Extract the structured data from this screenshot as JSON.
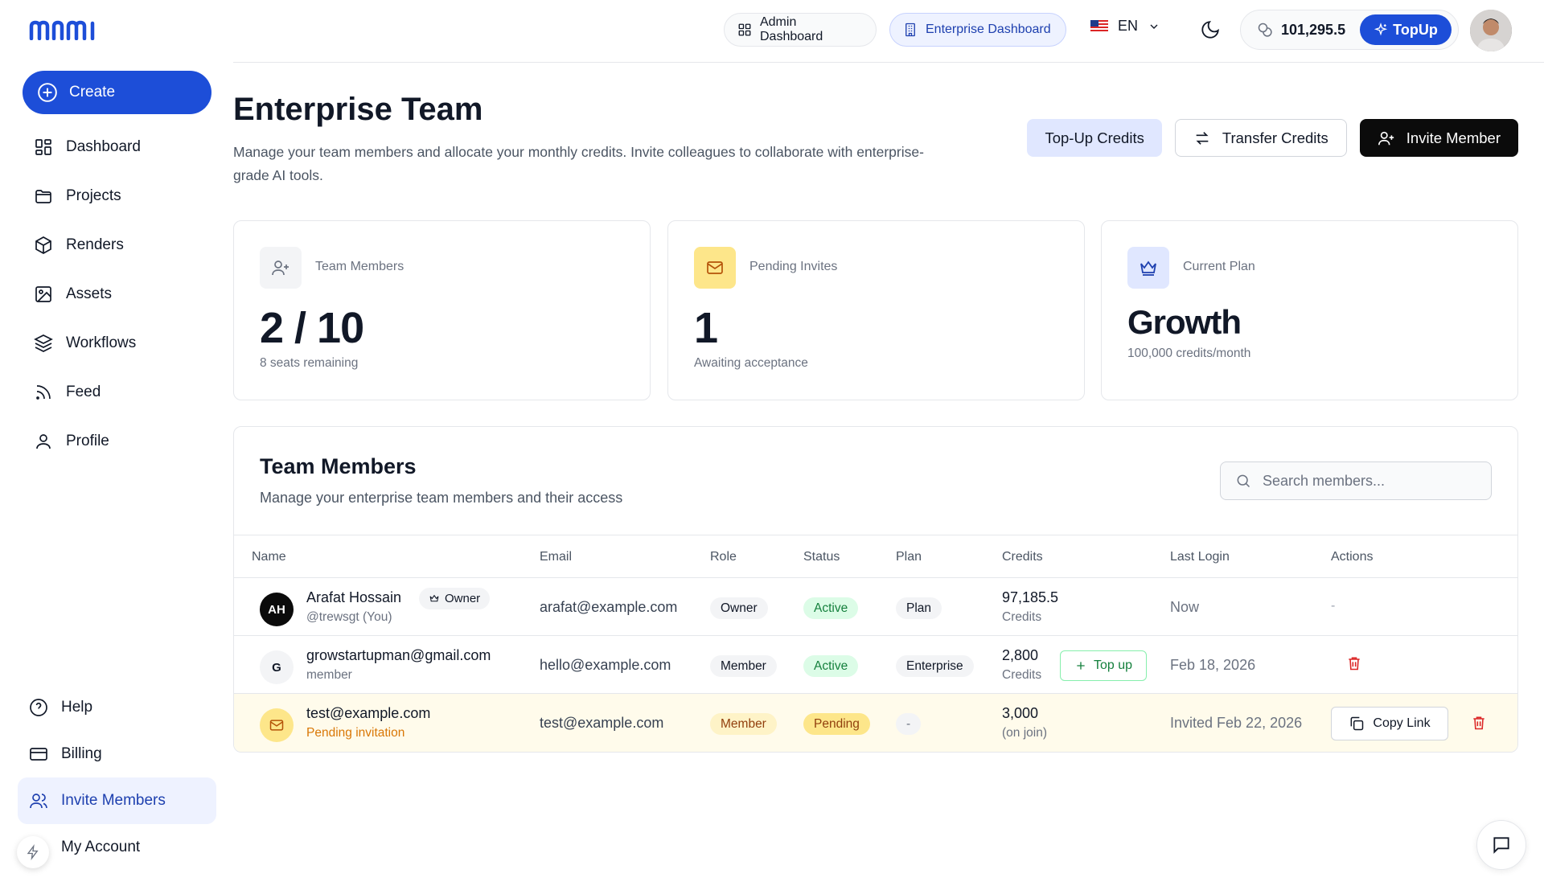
{
  "brand": {
    "logo_text": "mnmi",
    "accent": "#1d4ed8"
  },
  "sidebar": {
    "create_label": "Create",
    "items": [
      {
        "label": "Dashboard",
        "icon": "dashboard-icon"
      },
      {
        "label": "Projects",
        "icon": "folder-icon"
      },
      {
        "label": "Renders",
        "icon": "cube-icon"
      },
      {
        "label": "Assets",
        "icon": "image-icon"
      },
      {
        "label": "Workflows",
        "icon": "layers-icon"
      },
      {
        "label": "Feed",
        "icon": "rss-icon"
      },
      {
        "label": "Profile",
        "icon": "user-icon"
      }
    ],
    "bottom_items": [
      {
        "label": "Help",
        "icon": "help-icon"
      },
      {
        "label": "Billing",
        "icon": "card-icon"
      },
      {
        "label": "Invite Members",
        "icon": "users-icon",
        "active": true
      },
      {
        "label": "My Account",
        "icon": "account-icon"
      }
    ]
  },
  "topbar": {
    "admin_label": "Admin Dashboard",
    "enterprise_label": "Enterprise Dashboard",
    "language": "EN",
    "credits": "101,295.5",
    "topup_label": "TopUp"
  },
  "page": {
    "title": "Enterprise Team",
    "description": "Manage your team members and allocate your monthly credits. Invite colleagues to collaborate with enterprise-grade AI tools.",
    "actions": {
      "topup": "Top-Up Credits",
      "transfer": "Transfer Credits",
      "invite": "Invite Member"
    }
  },
  "stats": [
    {
      "label": "Team Members",
      "value": "2 / 10",
      "sub": "8 seats remaining"
    },
    {
      "label": "Pending Invites",
      "value": "1",
      "sub": "Awaiting acceptance"
    },
    {
      "label": "Current Plan",
      "value": "Growth",
      "sub": "100,000 credits/month"
    }
  ],
  "team": {
    "title": "Team Members",
    "description": "Manage your enterprise team members and their access",
    "search_placeholder": "Search members...",
    "columns": [
      "Name",
      "Email",
      "Role",
      "Status",
      "Plan",
      "Credits",
      "Last Login",
      "Actions"
    ],
    "rows": [
      {
        "initials": "AH",
        "name": "Arafat Hossain",
        "owner_tag": "Owner",
        "handle": "@trewsgt (You)",
        "email": "arafat@example.com",
        "role": "Owner",
        "status": "Active",
        "plan": "Plan",
        "credits": "97,185.5",
        "credits_sub": "Credits",
        "last_login": "Now",
        "action": "-"
      },
      {
        "initials": "G",
        "name": "growstartupman@gmail.com",
        "handle": "member",
        "email": "hello@example.com",
        "role": "Member",
        "status": "Active",
        "plan": "Enterprise",
        "credits": "2,800",
        "credits_sub": "Credits",
        "topup_label": "Top up",
        "last_login": "Feb 18, 2026"
      },
      {
        "name": "test@example.com",
        "handle": "Pending invitation",
        "email": "test@example.com",
        "role": "Member",
        "status": "Pending",
        "plan": "-",
        "credits": "3,000",
        "credits_sub": "(on join)",
        "last_login": "Invited Feb 22, 2026",
        "copy_label": "Copy Link"
      }
    ]
  }
}
